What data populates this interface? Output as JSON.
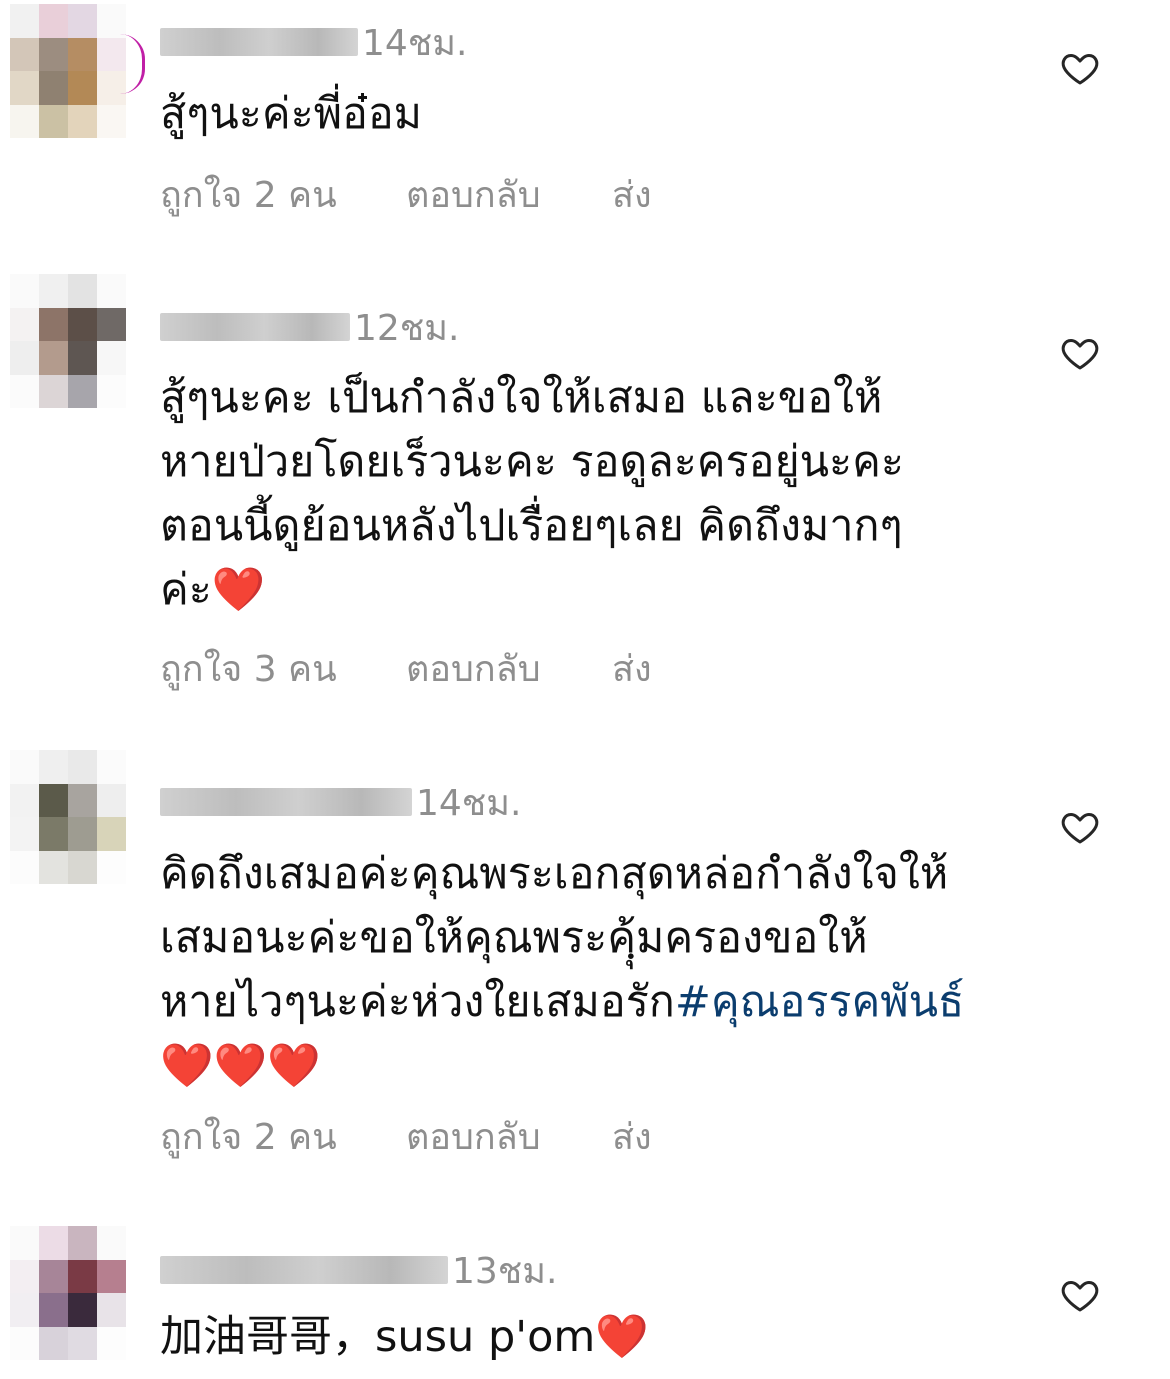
{
  "comments": [
    {
      "time": "14ชม.",
      "text": "สู้ๆนะค่ะพี่อ๋อม",
      "likes": "ถูกใจ 2 คน",
      "reply": "ตอบกลับ",
      "send": "ส่ง"
    },
    {
      "time": "12ชม.",
      "text": "สู้ๆนะคะ เป็นกำลังใจให้เสมอ และขอให้\nหายป่วยโดยเร็วนะคะ รอดูละครอยู่นะคะ\nตอนนี้ดูย้อนหลังไปเรื่อยๆเลย คิดถึงมากๆ\nค่ะ❤️",
      "likes": "ถูกใจ 3 คน",
      "reply": "ตอบกลับ",
      "send": "ส่ง"
    },
    {
      "time": "14ชม.",
      "text": "คิดถึงเสมอค่ะคุณพระเอกสุดหล่อกำลังใจให้\nเสมอนะค่ะขอให้คุณพระคฺุ้มครองขอให้\nหายไวๆนะค่ะห่วงใยเสมอรัก",
      "hashtag": "#คุณอรรคพันธ์",
      "emoji_line": "❤️❤️❤️",
      "likes": "ถูกใจ 2 คน",
      "reply": "ตอบกลับ",
      "send": "ส่ง"
    },
    {
      "time": "13ชม.",
      "text": "加油哥哥，susu p'om❤️"
    }
  ],
  "icons": {
    "like": "heart-outline-icon"
  },
  "colors": {
    "muted": "#8e8e8e",
    "hashtag": "#0b3d6e",
    "story_ring": "#c01fa6"
  }
}
